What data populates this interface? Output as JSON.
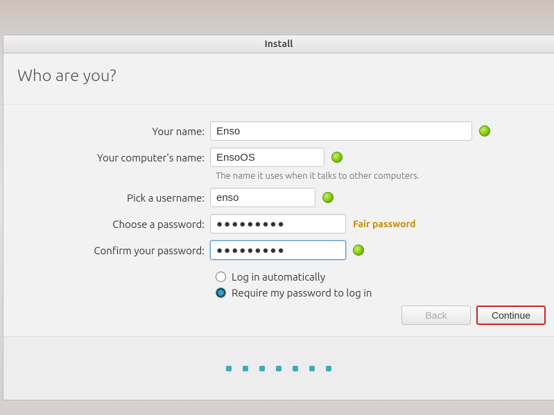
{
  "window": {
    "title": "Install"
  },
  "header": {
    "title": "Who are you?"
  },
  "form": {
    "name_label": "Your name:",
    "name_value": "Enso",
    "computer_label": "Your computer's name:",
    "computer_value": "EnsoOS",
    "computer_helper": "The name it uses when it talks to other computers.",
    "username_label": "Pick a username:",
    "username_value": "enso",
    "password_label": "Choose a password:",
    "password_value": "●●●●●●●●●",
    "password_strength": "Fair password",
    "confirm_label": "Confirm your password:",
    "confirm_value": "●●●●●●●●●",
    "login_auto_label": "Log in automatically",
    "login_require_label": "Require my password to log in",
    "login_selected": "require"
  },
  "buttons": {
    "back": "Back",
    "continue": "Continue"
  },
  "progress": {
    "steps": 7
  }
}
